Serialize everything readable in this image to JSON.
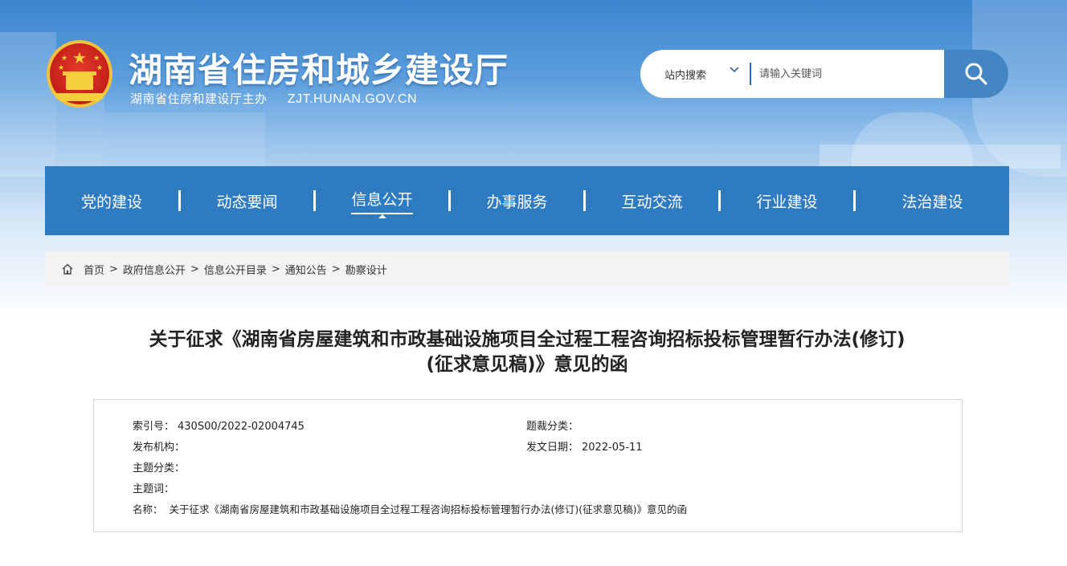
{
  "header": {
    "site_name": "湖南省住房和城乡建设厅",
    "sponsor": "湖南省住房和建设厅主办",
    "url": "ZJT.HUNAN.GOV.CN"
  },
  "search": {
    "scope": "站内搜索",
    "placeholder": "请输入关键词",
    "button_icon": "search-icon"
  },
  "nav": {
    "items": [
      {
        "label": "党的建设"
      },
      {
        "label": "动态要闻"
      },
      {
        "label": "信息公开",
        "active": true
      },
      {
        "label": "办事服务"
      },
      {
        "label": "互动交流"
      },
      {
        "label": "行业建设"
      },
      {
        "label": "法治建设"
      }
    ]
  },
  "breadcrumb": {
    "home_icon": "home-icon",
    "items": [
      "首页",
      "政府信息公开",
      "信息公开目录",
      "通知公告",
      "勘察设计"
    ],
    "separator": ">"
  },
  "article": {
    "title_line1": "关于征求《湖南省房屋建筑和市政基础设施项目全过程工程咨询招标投标管理暂行办法(修订)",
    "title_line2": "(征求意见稿)》意见的函",
    "meta": {
      "index_label": "索引号：",
      "index_value": "430S00/2022-02004745",
      "category_label": "题裁分类：",
      "category_value": "",
      "publisher_label": "发布机构：",
      "publisher_value": "",
      "date_label": "发文日期：",
      "date_value": "2022-05-11",
      "topic_label": "主题分类：",
      "topic_value": "",
      "keywords_label": "主题词：",
      "keywords_value": "",
      "name_label": "名称：",
      "name_value": "关于征求《湖南省房屋建筑和市政基础设施项目全过程工程咨询招标投标管理暂行办法(修订)(征求意见稿)》意见的函"
    }
  },
  "colors": {
    "nav_bg": "#2f7bc1",
    "search_button": "#4485c3",
    "banner_top": "#3d86cf"
  }
}
